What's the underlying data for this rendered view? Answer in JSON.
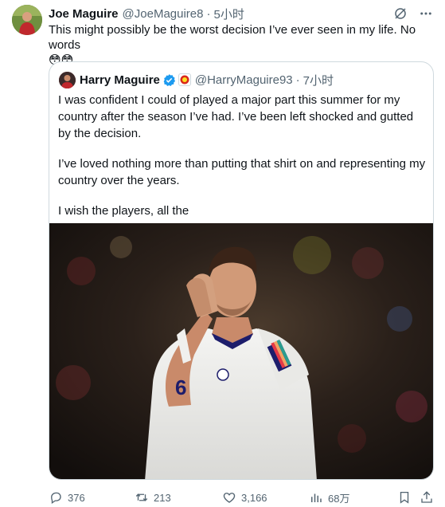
{
  "tweet": {
    "author_name": "Joe Maguire",
    "author_handle": "@JoeMaguire8",
    "separator": "·",
    "time": "5小时",
    "text": "This might possibly be the worst decision I’ve ever seen in my life. No words",
    "emojis": "😳😳"
  },
  "quote": {
    "author_name": "Harry Maguire",
    "author_handle": "@HarryMaguire93",
    "separator": "·",
    "time": "7小时",
    "paragraphs": [
      "I was confident I could of played a major part this summer for my country after the season I’ve had. I’ve been left shocked and gutted by the decision.",
      "I’ve loved nothing more than putting that shirt on and representing my country over the years.",
      "I wish the players, all the"
    ],
    "photo": {
      "shirt_number": "6"
    }
  },
  "actions": {
    "replies": "376",
    "retweets": "213",
    "likes": "3,166",
    "views": "68万"
  },
  "colors": {
    "text": "#0f1419",
    "secondary": "#536471",
    "verified": "#1d9bf0",
    "border": "#cfd9de"
  }
}
